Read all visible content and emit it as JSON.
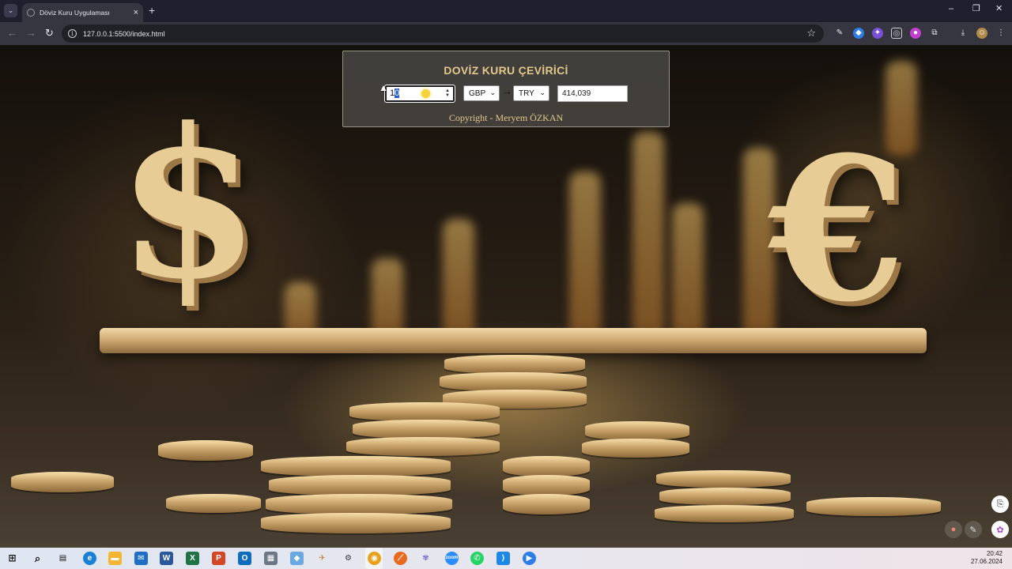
{
  "browser": {
    "tab_title": "Döviz Kuru Uygulaması",
    "url": "127.0.0.1:5500/index.html"
  },
  "converter": {
    "title": "DOVİZ KURU ÇEVİRİCİ",
    "amount_value": "1",
    "amount_selected_part": "0",
    "from_currency": "GBP",
    "to_currency": "TRY",
    "result": "414,039",
    "copyright": "Copyright - Meryem ÖZKAN"
  },
  "taskbar": {
    "time": "20:42",
    "date": "27.06.2024"
  },
  "colors": {
    "title_gold": "#e3c88c",
    "card_bg": "#484642",
    "chrome_dark": "#35363f"
  }
}
